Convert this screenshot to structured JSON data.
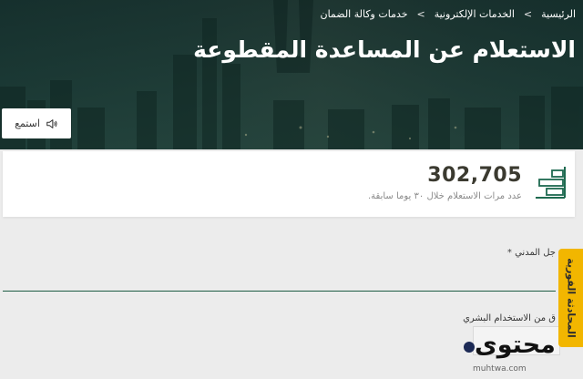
{
  "breadcrumb": {
    "items": [
      "الرئيسية",
      "الخدمات الإلكترونية",
      "خدمات وكالة الضمان"
    ],
    "separator": "<"
  },
  "page_title": "الاستعلام عن المساعدة المقطوعة",
  "listen_button": {
    "label": "استمع",
    "icon": "speaker-icon"
  },
  "stats": {
    "value": "302,705",
    "label": "عدد مرات الاستعلام خلال ٣٠ يوما سابقة.",
    "icon": "bar-chart-icon"
  },
  "form": {
    "id_label": "جل المدني",
    "required_mark": "*",
    "id_value": "",
    "captcha_label": "ق من الاستخدام البشري"
  },
  "side_tab": {
    "label": "المحادثة الفورية"
  },
  "watermark": {
    "text": "محتوى",
    "domain": "muhtwa.com"
  },
  "colors": {
    "hero_overlay": "#163430",
    "input_border": "#1e5c44",
    "side_tab": "#f2b600",
    "stats_icon": "#1e6a50"
  }
}
